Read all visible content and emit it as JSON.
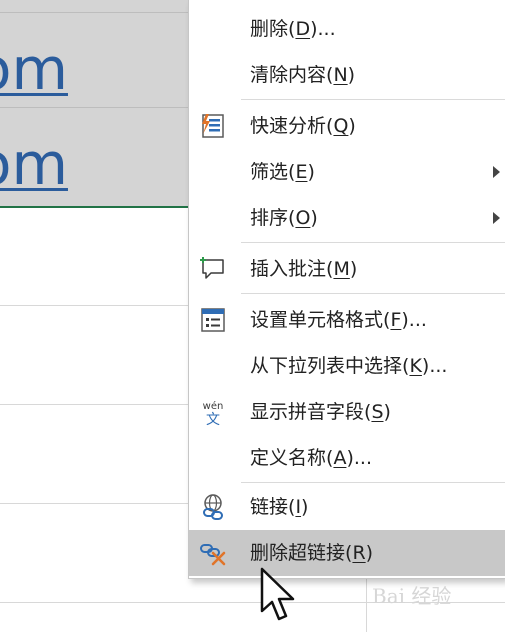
{
  "sheet": {
    "cell_row1_text": "om",
    "cell_row2_text": "om"
  },
  "menu": {
    "items": [
      {
        "label": "删除",
        "key": "D",
        "suffix": "..."
      },
      {
        "label": "清除内容",
        "key": "N",
        "suffix": ""
      },
      {
        "label": "快速分析",
        "key": "Q",
        "suffix": ""
      },
      {
        "label": "筛选",
        "key": "E",
        "suffix": ""
      },
      {
        "label": "排序",
        "key": "O",
        "suffix": ""
      },
      {
        "label": "插入批注",
        "key": "M",
        "suffix": ""
      },
      {
        "label": "设置单元格格式",
        "key": "F",
        "suffix": "..."
      },
      {
        "label": "从下拉列表中选择",
        "key": "K",
        "suffix": "..."
      },
      {
        "label": "显示拼音字段",
        "key": "S",
        "suffix": ""
      },
      {
        "label": "定义名称",
        "key": "A",
        "suffix": "..."
      },
      {
        "label": "链接",
        "key": "I",
        "suffix": ""
      },
      {
        "label": "删除超链接",
        "key": "R",
        "suffix": ""
      }
    ]
  },
  "icons": {
    "quick_analysis": "quick-analysis-icon",
    "insert_comment": "comment-icon",
    "format_cells": "format-cells-icon",
    "phonetic": "phonetic-icon",
    "phonetic_text_top": "wén",
    "phonetic_text_bottom": "文",
    "link": "link-icon",
    "remove_link": "remove-link-icon"
  },
  "watermark": {
    "text": "Bai 经验"
  },
  "colors": {
    "link_text": "#2b5c9c",
    "hover_bg": "#c8c8c8",
    "selection_bg": "#d4d4d4",
    "excel_green": "#217346",
    "icon_blue": "#2f6db5",
    "icon_orange": "#e0742a"
  }
}
